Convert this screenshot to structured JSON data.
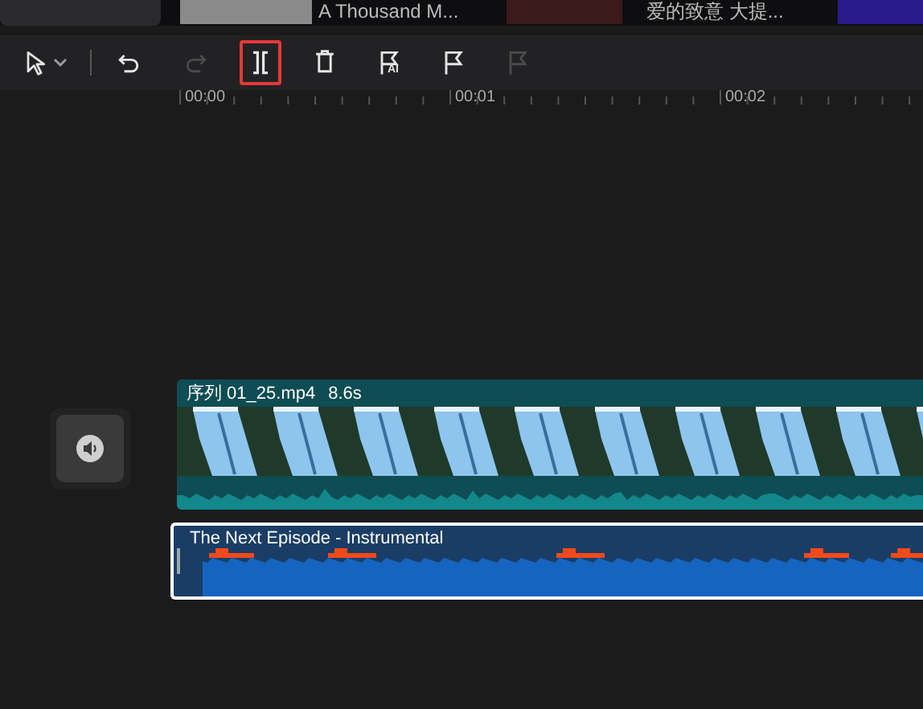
{
  "media_strip": [
    {
      "title": "A Thousand M..."
    },
    {
      "title": "爱的致意 大提..."
    }
  ],
  "toolbar": {
    "tools": [
      {
        "kind": "select",
        "selected": false,
        "disabled": false
      },
      {
        "kind": "undo",
        "selected": false,
        "disabled": false
      },
      {
        "kind": "redo",
        "selected": false,
        "disabled": true
      },
      {
        "kind": "split",
        "selected": true,
        "disabled": false
      },
      {
        "kind": "delete",
        "selected": false,
        "disabled": false
      },
      {
        "kind": "ai-marker",
        "selected": false,
        "disabled": false,
        "badge": "AI"
      },
      {
        "kind": "marker",
        "selected": false,
        "disabled": false
      },
      {
        "kind": "marker",
        "selected": false,
        "disabled": true
      }
    ]
  },
  "ruler": {
    "labels": [
      "00:00",
      "00:01",
      "00:02"
    ]
  },
  "tracks": {
    "mute_button": {
      "muted": false
    },
    "video_clip": {
      "name": "序列 01_25.mp4",
      "duration": "8.6s"
    },
    "audio_clip": {
      "name": "The Next Episode - Instrumental",
      "selected": true
    }
  }
}
